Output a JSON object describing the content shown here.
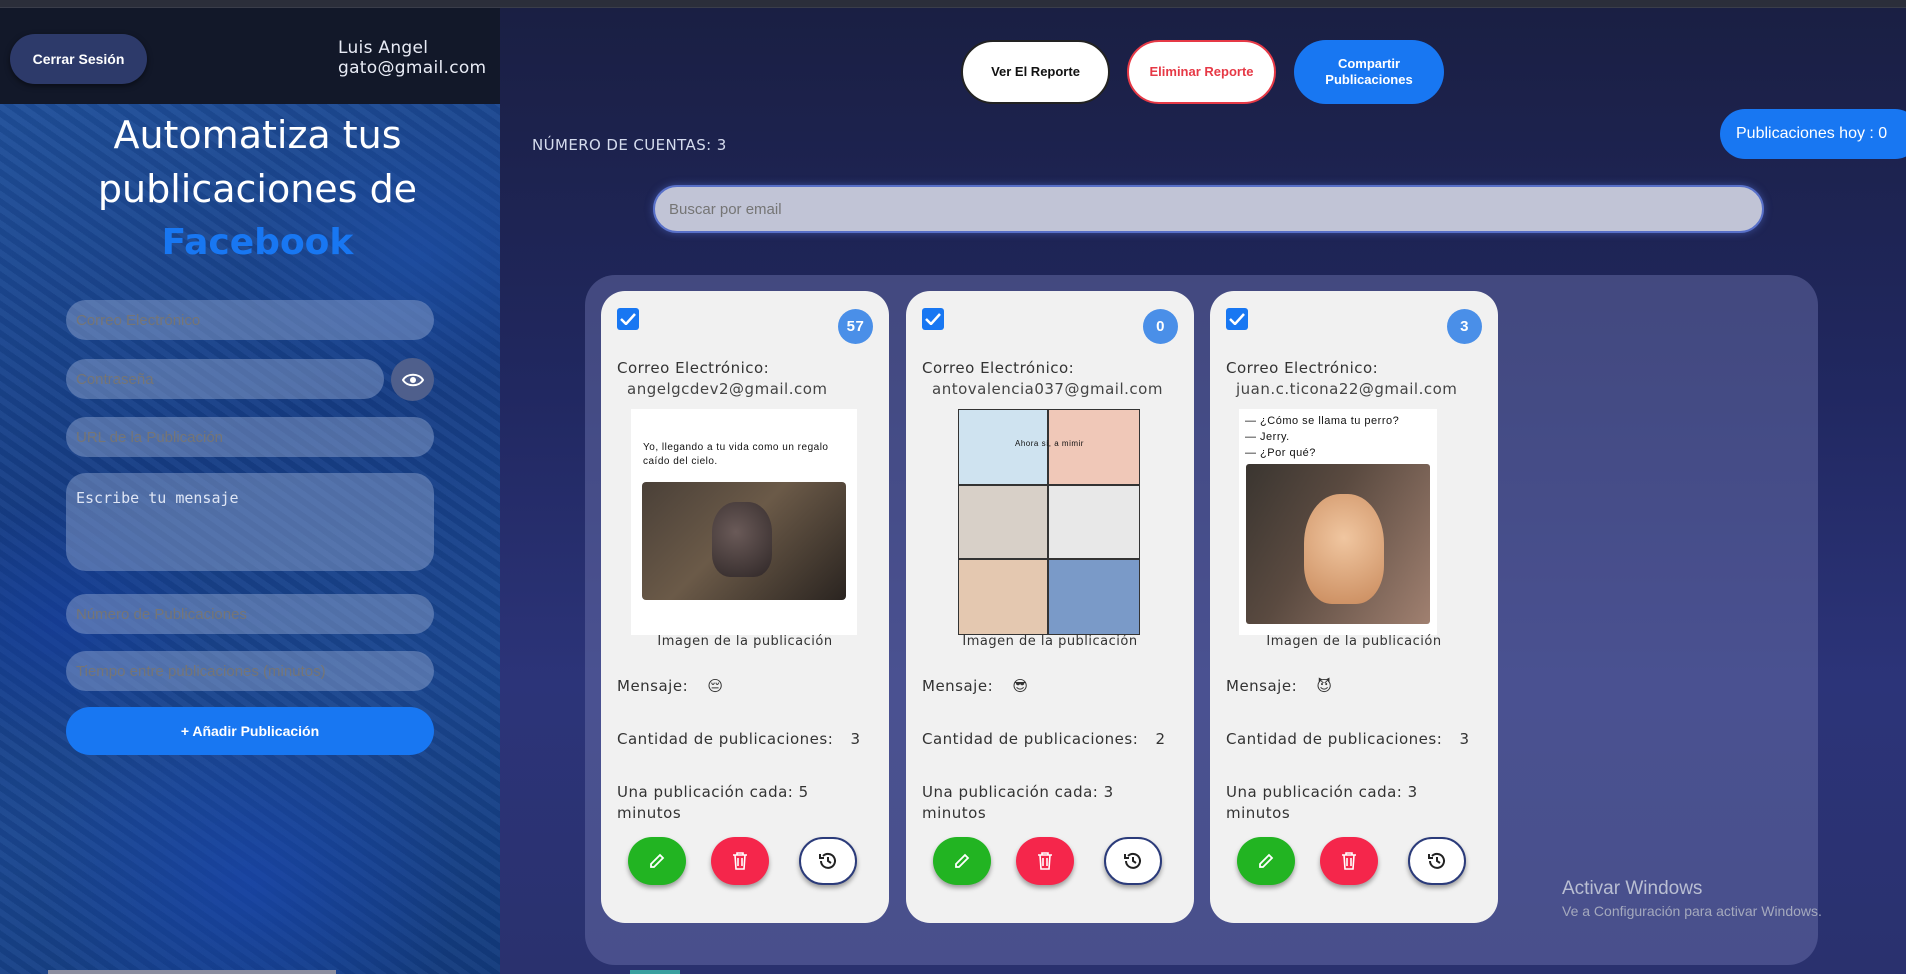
{
  "header": {
    "logout_label": "Cerrar Sesión",
    "user_name": "Luis Angel",
    "user_email": "gato@gmail.com"
  },
  "hero": {
    "line1": "Automatiza tus",
    "line2": "publicaciones de",
    "brand": "Facebook"
  },
  "form": {
    "email_placeholder": "Correo Electrónico",
    "password_placeholder": "Contraseña",
    "url_placeholder": "URL de la Publicación",
    "message_placeholder": "Escribe tu mensaje",
    "count_placeholder": "Número de Publicaciones",
    "interval_placeholder": "Tiempo entre publicaciones (minutos)",
    "add_label": "+ Añadir Publicación"
  },
  "toolbar": {
    "view_label": "Ver El Reporte",
    "delete_label": "Eliminar Reporte",
    "share_label": "Compartir Publicaciones"
  },
  "accounts_count_label": "NÚMERO DE CUENTAS: 3",
  "publications_today": "Publicaciones hoy : 0",
  "search": {
    "placeholder": "Buscar por email"
  },
  "card_labels": {
    "email": "Correo Electrónico:",
    "image_caption": "Imagen de la publicación",
    "message": "Mensaje:",
    "quantity": "Cantidad de publicaciones:"
  },
  "cards": [
    {
      "badge": "57",
      "email": "angelgcdev2@gmail.com",
      "message_emoji": "😔",
      "quantity": "3",
      "frequency": "Una publicación cada: 5 minutos",
      "image_text": "Yo, llegando a tu vida como un regalo caído del cielo."
    },
    {
      "badge": "0",
      "email": "antovalencia037@gmail.com",
      "message_emoji": "😎",
      "quantity": "2",
      "frequency": "Una publicación cada: 3 minutos",
      "image_text": "Ahora sí, a mimir"
    },
    {
      "badge": "3",
      "email": "juan.c.ticona22@gmail.com",
      "message_emoji": "😈",
      "quantity": "3",
      "frequency": "Una publicación cada: 3 minutos",
      "image_text": "— ¿Cómo se llama tu perro?\n— Jerry.\n— ¿Por qué?"
    }
  ],
  "windows_watermark": {
    "title": "Activar Windows",
    "subtitle": "Ve a Configuración para activar Windows."
  },
  "colors": {
    "accent": "#1877f2",
    "edit": "#22b422",
    "delete": "#f5264b"
  }
}
